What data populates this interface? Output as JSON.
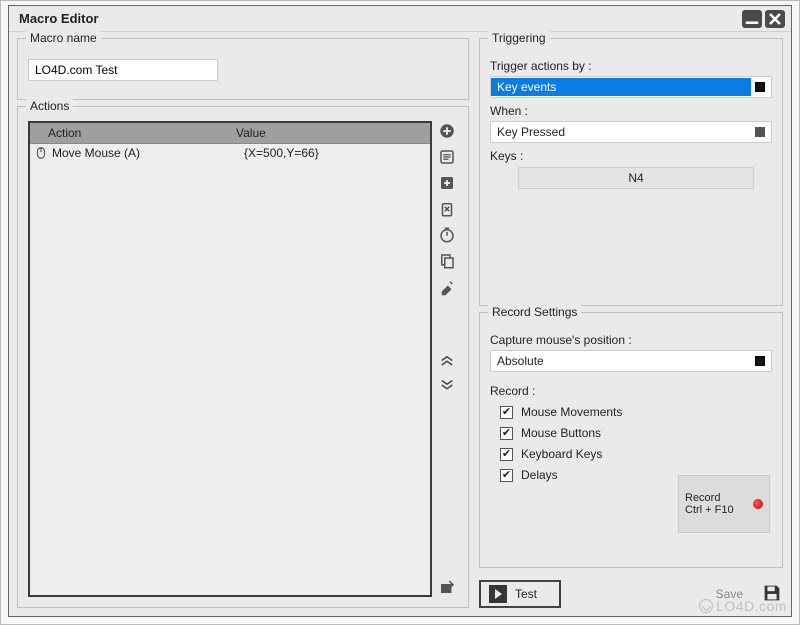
{
  "window": {
    "title": "Macro Editor"
  },
  "macro_name": {
    "label": "Macro name",
    "value": "LO4D.com Test"
  },
  "actions": {
    "title": "Actions",
    "columns": {
      "action": "Action",
      "value": "Value"
    },
    "rows": [
      {
        "action": "Move Mouse (A)",
        "value": "{X=500,Y=66}"
      }
    ],
    "toolbar": {
      "add": "add",
      "edit": "edit",
      "add_box": "add-box",
      "delete": "delete",
      "timer": "timer",
      "duplicate": "duplicate",
      "clear": "clear",
      "move_up": "move-up",
      "move_down": "move-down",
      "export": "export"
    }
  },
  "triggering": {
    "title": "Triggering",
    "trigger_by_label": "Trigger actions by :",
    "trigger_by_value": "Key events",
    "when_label": "When :",
    "when_value": "Key Pressed",
    "keys_label": "Keys :",
    "keys_value": "N4"
  },
  "record_settings": {
    "title": "Record Settings",
    "capture_label": "Capture mouse's position :",
    "capture_value": "Absolute",
    "record_label": "Record :",
    "options": {
      "mouse_movements": "Mouse Movements",
      "mouse_buttons": "Mouse Buttons",
      "keyboard_keys": "Keyboard Keys",
      "delays": "Delays"
    },
    "record_box": {
      "line1": "Record",
      "line2": "Ctrl + F10"
    }
  },
  "bottom": {
    "test": "Test",
    "save": "Save"
  },
  "watermark": "LO4D.com"
}
